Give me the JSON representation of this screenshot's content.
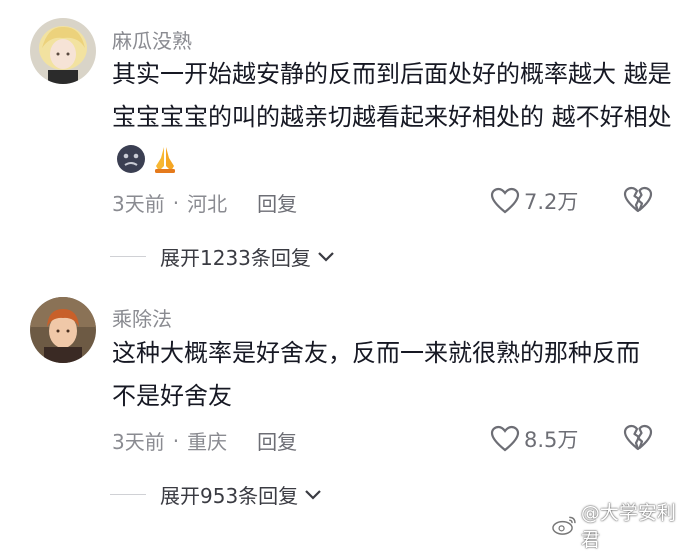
{
  "comments": [
    {
      "username": "麻瓜没熟",
      "text": "其实一开始越安静的反而到后面处好的概率越大 越是宝宝宝宝的叫的越亲切越看起来好相处的 越不好相处",
      "time": "3天前",
      "location": "河北",
      "reply_label": "回复",
      "likes": "7.2万",
      "expand_label": "展开1233条回复"
    },
    {
      "username": "乘除法",
      "text": "这种大概率是好舍友，反而一来就很熟的那种反而不是好舍友",
      "time": "3天前",
      "location": "重庆",
      "reply_label": "回复",
      "likes": "8.5万",
      "expand_label": "展开953条回复"
    }
  ],
  "meta_separator": "·",
  "watermark": "@大学安利君",
  "icons": {
    "like": "heart-outline-icon",
    "dislike": "broken-heart-icon",
    "expand": "chevron-down-icon",
    "weibo": "weibo-logo-icon"
  }
}
